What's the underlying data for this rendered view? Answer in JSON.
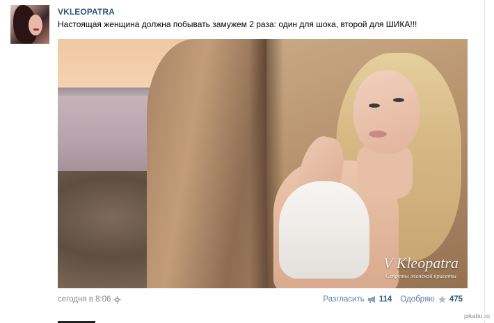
{
  "post": {
    "author": "VKLEOPATRA",
    "text": "Настоящая женщина должна побывать замужем 2 раза: один для шока, второй для ШИКА!!!",
    "timestamp": "сегодня в 8:06",
    "watermark": {
      "title": "V Kleopatra",
      "subtitle": "Секреты женской красоты"
    }
  },
  "actions": {
    "share": {
      "label": "Разгласить",
      "count": "114",
      "icon": "megaphone-icon"
    },
    "like": {
      "label": "Одобряю",
      "count": "475",
      "icon": "star-icon"
    }
  },
  "site_label": "pikabu.ru",
  "colors": {
    "link": "#2b587a",
    "action": "#5b7fa6",
    "muted": "#888888"
  }
}
